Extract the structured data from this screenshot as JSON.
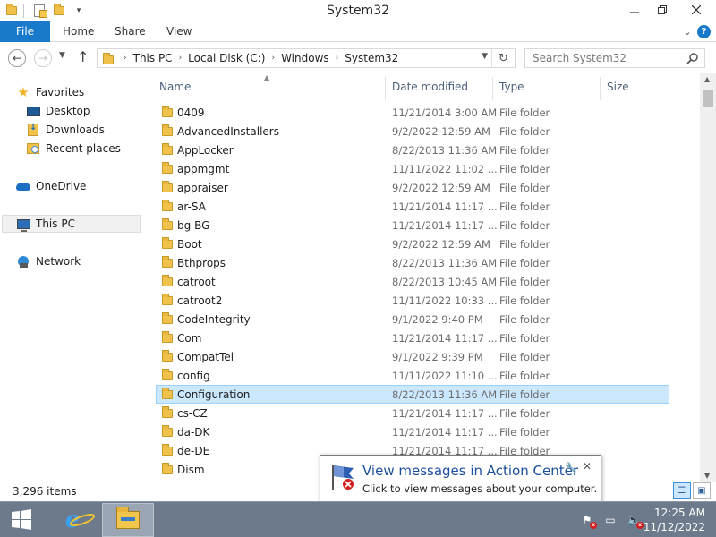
{
  "window": {
    "title": "System32"
  },
  "ribbon": {
    "tabs": [
      {
        "label": "File"
      },
      {
        "label": "Home"
      },
      {
        "label": "Share"
      },
      {
        "label": "View"
      }
    ]
  },
  "address": {
    "breadcrumbs": [
      "This PC",
      "Local Disk (C:)",
      "Windows",
      "System32"
    ],
    "search_placeholder": "Search System32"
  },
  "nav_pane": {
    "items": [
      {
        "label": "Favorites",
        "icon": "star-icon"
      },
      {
        "label": "Desktop",
        "icon": "desktop-icon"
      },
      {
        "label": "Downloads",
        "icon": "downloads-icon"
      },
      {
        "label": "Recent places",
        "icon": "recent-places-icon"
      },
      {
        "label": "OneDrive",
        "icon": "onedrive-icon"
      },
      {
        "label": "This PC",
        "icon": "this-pc-icon",
        "selected": true
      },
      {
        "label": "Network",
        "icon": "network-icon"
      }
    ]
  },
  "file_list": {
    "columns": [
      "Name",
      "Date modified",
      "Type",
      "Size"
    ],
    "rows": [
      {
        "name": "0409",
        "date": "11/21/2014 3:00 AM",
        "type": "File folder"
      },
      {
        "name": "AdvancedInstallers",
        "date": "9/2/2022 12:59 AM",
        "type": "File folder"
      },
      {
        "name": "AppLocker",
        "date": "8/22/2013 11:36 AM",
        "type": "File folder"
      },
      {
        "name": "appmgmt",
        "date": "11/11/2022 11:02 ...",
        "type": "File folder"
      },
      {
        "name": "appraiser",
        "date": "9/2/2022 12:59 AM",
        "type": "File folder"
      },
      {
        "name": "ar-SA",
        "date": "11/21/2014 11:17 ...",
        "type": "File folder"
      },
      {
        "name": "bg-BG",
        "date": "11/21/2014 11:17 ...",
        "type": "File folder"
      },
      {
        "name": "Boot",
        "date": "9/2/2022 12:59 AM",
        "type": "File folder"
      },
      {
        "name": "Bthprops",
        "date": "8/22/2013 11:36 AM",
        "type": "File folder"
      },
      {
        "name": "catroot",
        "date": "8/22/2013 10:45 AM",
        "type": "File folder"
      },
      {
        "name": "catroot2",
        "date": "11/11/2022 10:33 ...",
        "type": "File folder"
      },
      {
        "name": "CodeIntegrity",
        "date": "9/1/2022 9:40 PM",
        "type": "File folder"
      },
      {
        "name": "Com",
        "date": "11/21/2014 11:17 ...",
        "type": "File folder"
      },
      {
        "name": "CompatTel",
        "date": "9/1/2022 9:39 PM",
        "type": "File folder"
      },
      {
        "name": "config",
        "date": "11/11/2022 11:10 ...",
        "type": "File folder"
      },
      {
        "name": "Configuration",
        "date": "8/22/2013 11:36 AM",
        "type": "File folder",
        "selected": true
      },
      {
        "name": "cs-CZ",
        "date": "11/21/2014 11:17 ...",
        "type": "File folder"
      },
      {
        "name": "da-DK",
        "date": "11/21/2014 11:17 ...",
        "type": "File folder"
      },
      {
        "name": "de-DE",
        "date": "11/21/2014 11:17 ...",
        "type": "File folder"
      },
      {
        "name": "Dism",
        "date": "",
        "type": ""
      }
    ]
  },
  "status": {
    "item_count": "3,296 items"
  },
  "notification": {
    "title": "View messages in Action Center",
    "body": "Click to view messages about your computer."
  },
  "taskbar": {
    "time": "12:25 AM",
    "date": "11/12/2022"
  },
  "colors": {
    "accent": "#1979ca",
    "selection": "#cce8ff",
    "taskbar": "#6c7a8c"
  }
}
